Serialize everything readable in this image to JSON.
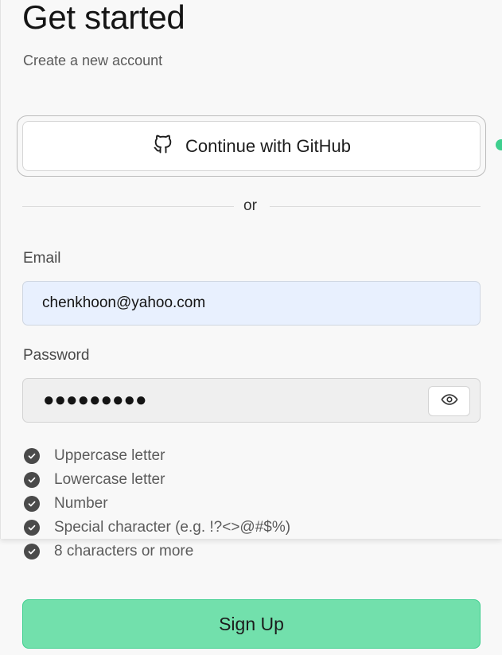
{
  "header": {
    "title": "Get started",
    "subtitle": "Create a new account"
  },
  "oauth": {
    "github_label": "Continue with GitHub",
    "icon": "github-icon"
  },
  "divider": {
    "text": "or"
  },
  "form": {
    "email_label": "Email",
    "email_value": "chenkhoon@yahoo.com",
    "password_label": "Password",
    "password_masked": "●●●●●●●●●",
    "show_password_icon": "eye-icon"
  },
  "password_requirements": [
    {
      "label": "Uppercase letter",
      "met": true
    },
    {
      "label": "Lowercase letter",
      "met": true
    },
    {
      "label": "Number",
      "met": true
    },
    {
      "label": "Special character (e.g. !?<>@#$%)",
      "met": true
    },
    {
      "label": "8 characters or more",
      "met": true
    }
  ],
  "actions": {
    "signup_label": "Sign Up"
  },
  "colors": {
    "brand_green": "#3ecf8e",
    "signup_bg": "#72e0ac",
    "email_autofill_bg": "#e8f0fe"
  }
}
